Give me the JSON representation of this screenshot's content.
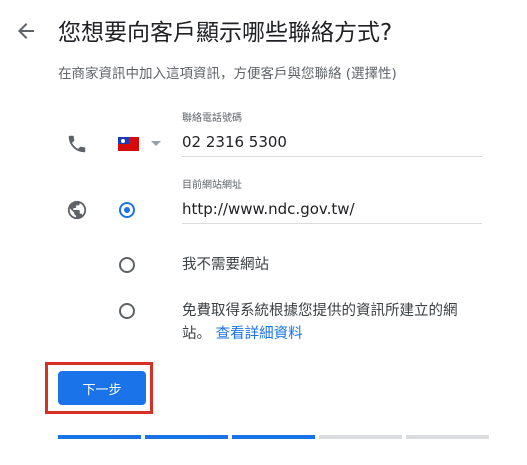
{
  "header": {
    "title": "您想要向客戶顯示哪些聯絡方式?",
    "subtitle": "在商家資訊中加入這項資訊，方便客戶與您聯絡 (選擇性)"
  },
  "phone": {
    "label": "聯絡電話號碼",
    "value": "02 2316 5300",
    "country_flag": "Taiwan"
  },
  "website": {
    "label": "目前網站網址",
    "value": "http://www.ndc.gov.tw/",
    "options": [
      {
        "label": "我不需要網站",
        "selected": false
      },
      {
        "label": "免費取得系統根據您提供的資訊所建立的網站。",
        "link": "查看詳細資料",
        "selected": false
      }
    ]
  },
  "actions": {
    "next_label": "下一步"
  },
  "progress": {
    "total_steps": 5,
    "completed_steps": 3
  },
  "colors": {
    "accent": "#1a73e8",
    "highlight": "#d93025",
    "progress_inactive": "#dadce0"
  }
}
